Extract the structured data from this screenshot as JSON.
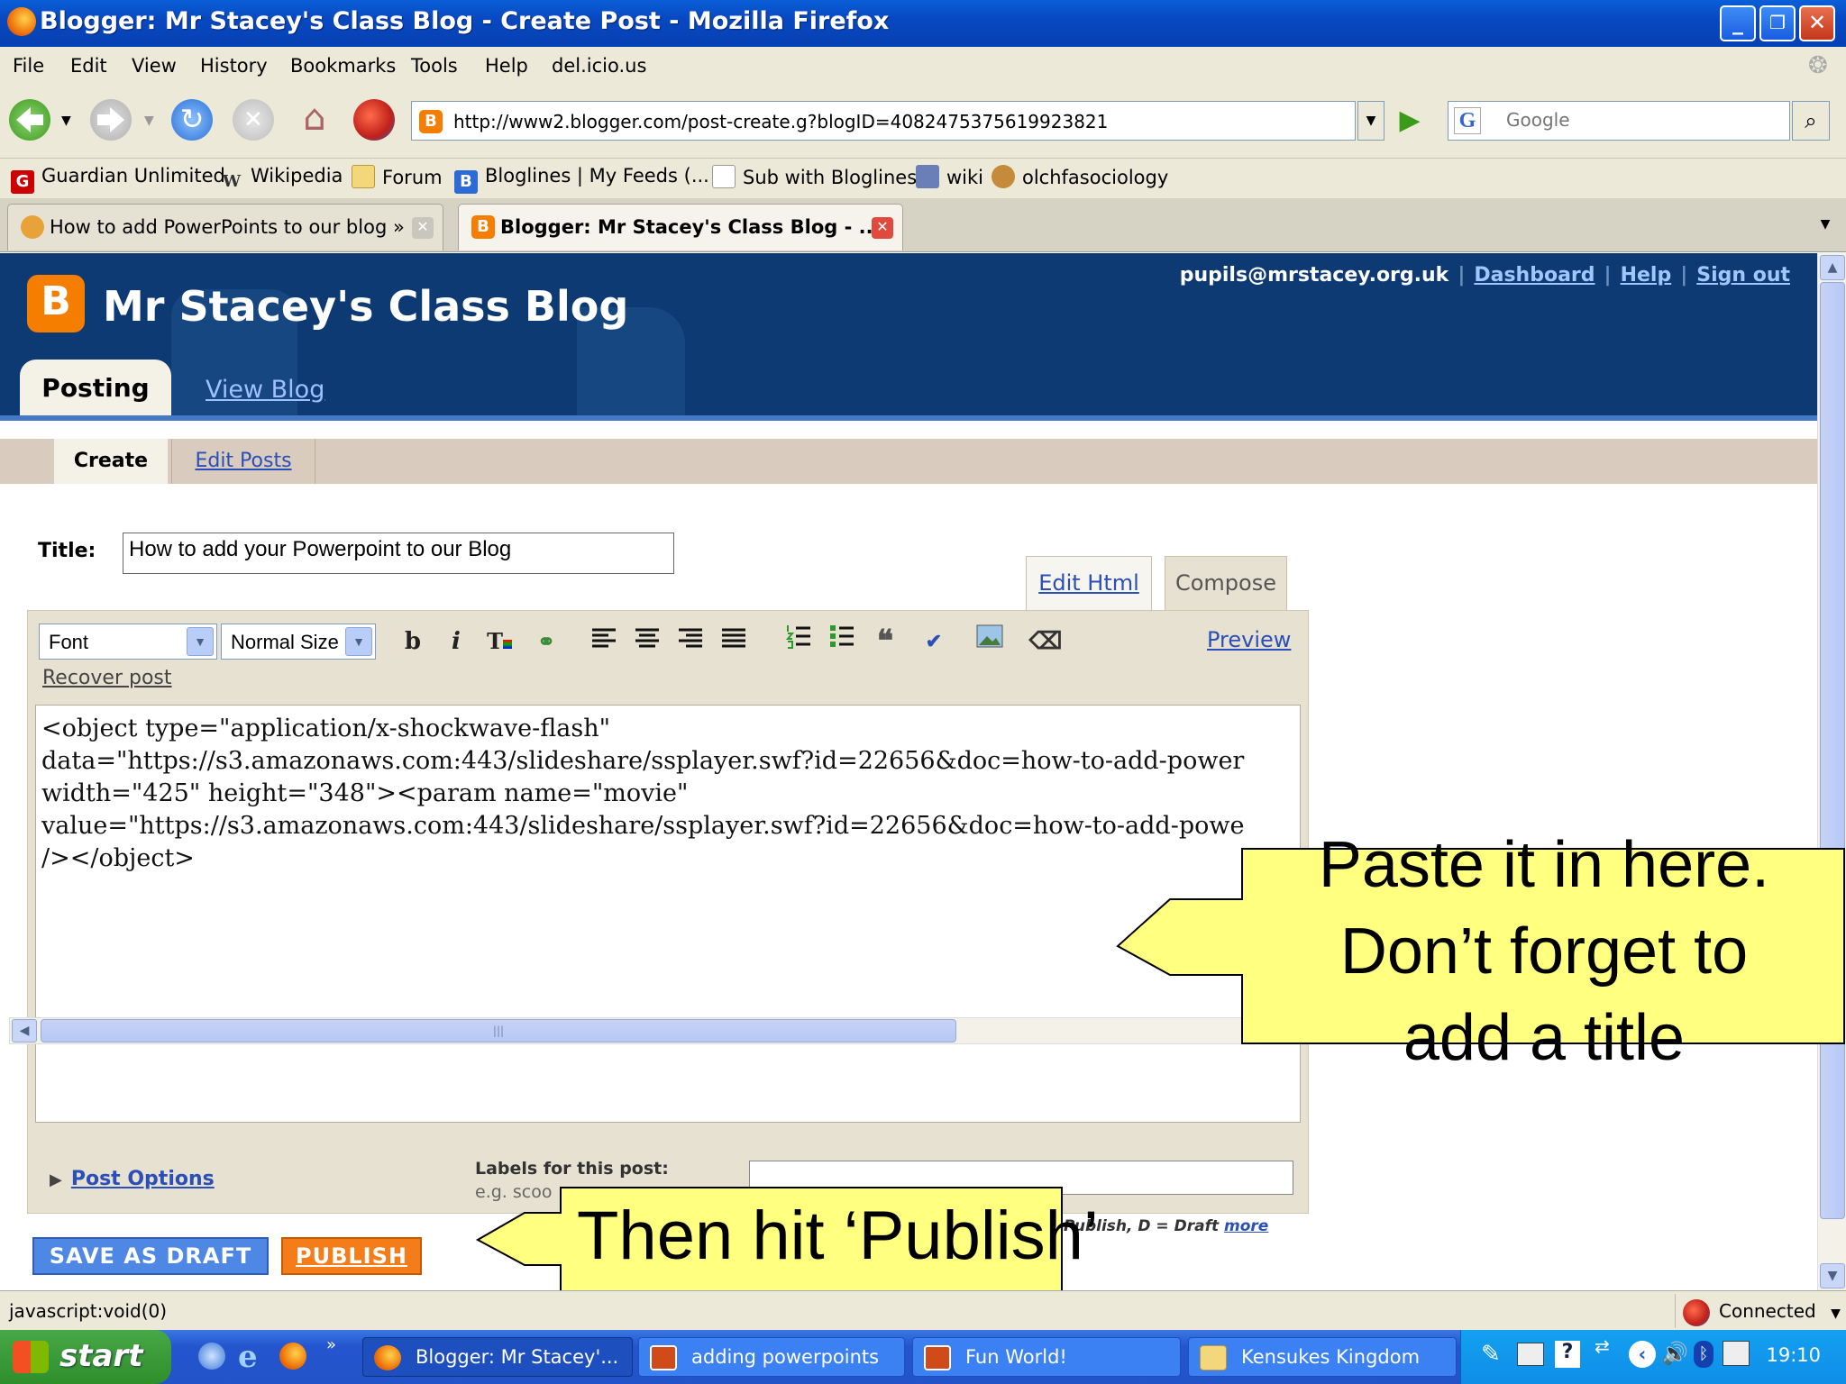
{
  "window": {
    "title": "Blogger: Mr Stacey's Class Blog - Create Post - Mozilla Firefox"
  },
  "menu": [
    "File",
    "Edit",
    "View",
    "History",
    "Bookmarks",
    "Tools",
    "Help",
    "del.icio.us"
  ],
  "nav": {
    "url": "http://www2.blogger.com/post-create.g?blogID=4082475375619923821",
    "search_placeholder": "Google"
  },
  "bookmarks": [
    "Guardian Unlimited",
    "Wikipedia",
    "Forum",
    "Bloglines | My Feeds (...",
    "Sub with Bloglines",
    "wiki",
    "olchfasociology"
  ],
  "tabs": [
    {
      "label": "How to add PowerPoints to our blog » ...",
      "active": false
    },
    {
      "label": "Blogger: Mr Stacey's Class Blog - ...",
      "active": true
    }
  ],
  "blog": {
    "logo_letter": "B",
    "title": "Mr Stacey's Class Blog",
    "user": "pupils@mrstacey.org.uk",
    "links": [
      "Dashboard",
      "Help",
      "Sign out"
    ],
    "main_tabs": {
      "posting": "Posting",
      "view_blog": "View Blog"
    },
    "sub_tabs": {
      "create": "Create",
      "edit_posts": "Edit Posts"
    }
  },
  "post": {
    "title_label": "Title:",
    "title_value": "How to add your Powerpoint to our Blog",
    "edit_html": "Edit Html",
    "compose": "Compose",
    "font_select": "Font",
    "size_select": "Normal Size",
    "preview": "Preview",
    "recover": "Recover post",
    "body": "<object type=\"application/x-shockwave-flash\"\ndata=\"https://s3.amazonaws.com:443/slideshare/ssplayer.swf?id=22656&doc=how-to-add-power\nwidth=\"425\" height=\"348\"><param name=\"movie\"\nvalue=\"https://s3.amazonaws.com:443/slideshare/ssplayer.swf?id=22656&doc=how-to-add-powe\n/></object>",
    "post_options": "Post Options",
    "labels_label": "Labels for this post:",
    "labels_example": "e.g. scoo",
    "shortcut_publish": "Publish",
    "shortcut_draft": "D = Draft",
    "shortcut_more": "more",
    "save_draft": "SAVE AS DRAFT",
    "publish": "PUBLISH"
  },
  "callouts": {
    "paste": [
      "Paste it in here.",
      "Don’t forget to",
      "add a title"
    ],
    "publish": "Then hit ‘Publish’"
  },
  "status": {
    "text": "javascript:void(0)",
    "connection": "Connected"
  },
  "taskbar": {
    "start": "start",
    "items": [
      "Blogger: Mr Stacey'...",
      "adding powerpoints",
      "Fun World!",
      "Kensukes Kingdom"
    ],
    "clock": "19:10"
  }
}
